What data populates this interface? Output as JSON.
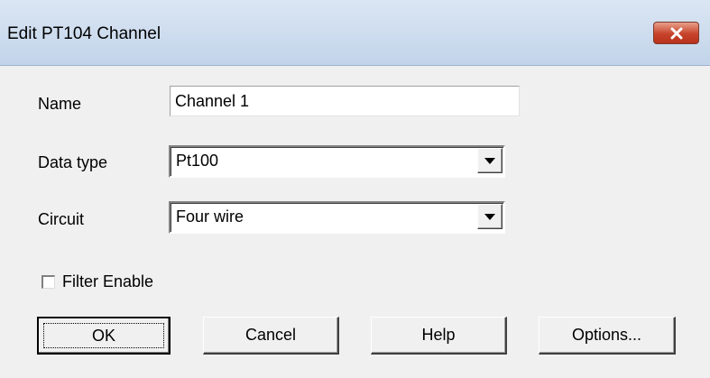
{
  "window": {
    "title": "Edit PT104 Channel",
    "close_icon": "close-icon"
  },
  "form": {
    "name": {
      "label": "Name",
      "value": "Channel 1"
    },
    "data_type": {
      "label": "Data type",
      "selected": "Pt100"
    },
    "circuit": {
      "label": "Circuit",
      "selected": "Four wire"
    },
    "filter_enable": {
      "label": "Filter Enable",
      "checked": false
    }
  },
  "buttons": {
    "ok": "OK",
    "cancel": "Cancel",
    "help": "Help",
    "options": "Options..."
  },
  "colors": {
    "title_bar": "#c9d9ee",
    "close_button": "#c7432b",
    "dialog_background": "#f0f0f0"
  }
}
